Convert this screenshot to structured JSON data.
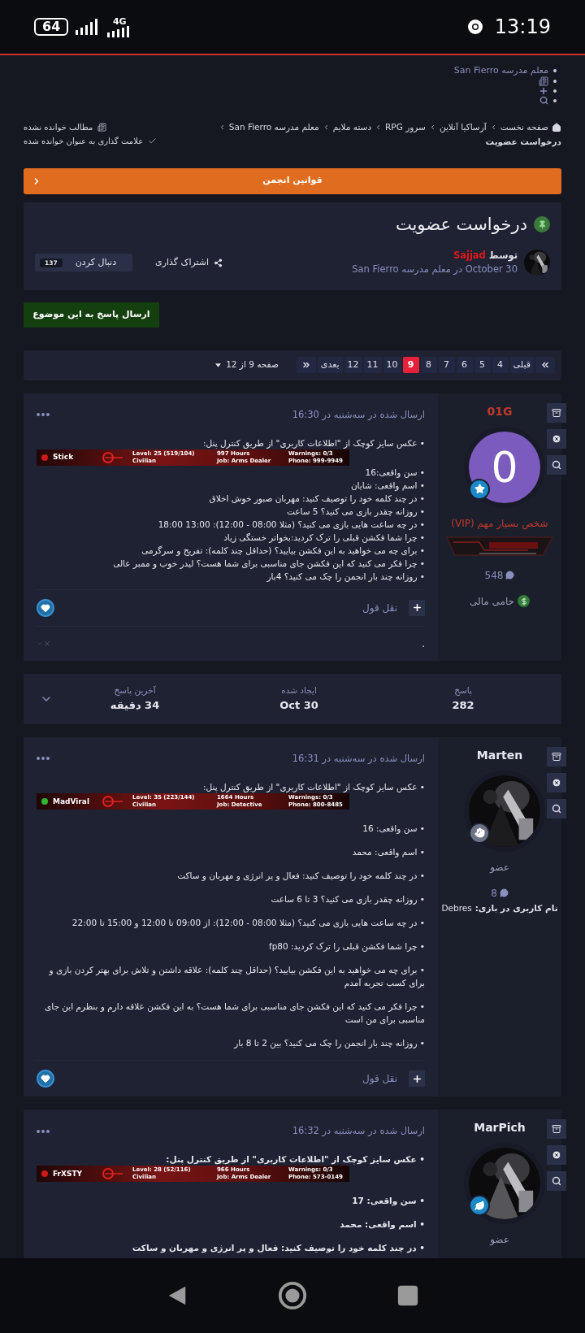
{
  "status_bar": {
    "battery": "64",
    "network": "4G",
    "time": "13:19"
  },
  "nav_list": [
    {
      "kind": "link",
      "label": "معلم مدرسه San Fierro"
    },
    {
      "kind": "unread"
    },
    {
      "kind": "add"
    },
    {
      "kind": "search"
    }
  ],
  "breadcrumb": {
    "items": [
      "صفحه نخست",
      "آرساکیا آنلاین",
      "سرور RPG",
      "دسته ملایم",
      "معلم مدرسه San Fierro"
    ],
    "current": "درخواست عضویت"
  },
  "topic_actions": [
    {
      "kind": "unread",
      "label": "مطالب خوانده نشده"
    },
    {
      "kind": "mark_read",
      "label": "علامت گذاری به عنوان خوانده شده"
    }
  ],
  "rules_bar": {
    "label": "قوانین انجمن"
  },
  "topic": {
    "title": "درخواست عضویت",
    "pinned": true,
    "by_label": "توسط",
    "author": "Sajjad",
    "meta": "October 30 در معلم مدرسه San Fierro",
    "share": "اشتراک گذاری",
    "follow": "دنبال کردن",
    "follow_count": "137"
  },
  "reply_button": "ارسال پاسخ به این موضوع",
  "pagination": {
    "pages": [
      {
        "label": "قبلی",
        "selected": false
      },
      {
        "label": "4",
        "selected": false
      },
      {
        "label": "5",
        "selected": false
      },
      {
        "label": "6",
        "selected": false
      },
      {
        "label": "7",
        "selected": false
      },
      {
        "label": "8",
        "selected": false
      },
      {
        "label": "9",
        "selected": true
      },
      {
        "label": "10",
        "selected": false
      },
      {
        "label": "11",
        "selected": false
      },
      {
        "label": "12",
        "selected": false
      },
      {
        "label": "بعدی",
        "selected": false
      }
    ],
    "page_jump": "صفحه 9 از 12"
  },
  "posts": [
    {
      "author": "01G",
      "color": "#c0392b",
      "avatar": {
        "kind": "letter",
        "letter": "0",
        "color": "#7b5bbd"
      },
      "badge": {
        "kind": "star"
      },
      "role": "شخص بسیار مهم (VIP)",
      "rank_banner": {
        "kind": "picture"
      },
      "post_count": "548",
      "extra": {
        "kind": "donor",
        "label": "حامی مالی"
      },
      "timestamp": "ارسال شده در سه‌شنبه در 16:30",
      "bold": false,
      "spaced": false,
      "intro": "• عکس سایز کوچک از \"اطلاعات کاربری\" از طریق کنترل پنل:",
      "banner": {
        "name": "Stick",
        "color": "#d01818",
        "level": "Level: 25 (519/104)",
        "class": "Civilian",
        "hours": "997 Hours",
        "job": "Job: Arms Dealer",
        "warnings": "Warnings: 0/3",
        "phone": "Phone: 999-9949"
      },
      "lines": [
        "• سن واقعی:16",
        "• اسم واقعی: شایان",
        "• در چند کلمه خود را توصیف کنید: مهربان صبور خوش اخلاق",
        "• روزانه چقدر بازی می کنید؟ 5 ساعت",
        "• در چه ساعت هایی بازی می کنید؟ (مثلا 08:00 - 12:00): 13:00  18:00",
        "• چرا شما فکشن قبلی را ترک کردید:بخواتر خستگی زیاد",
        "• برای چه می خواهید به این فکشن بیایید؟ (حداقل چند کلمه): تفریح و سرگرمی",
        "• چرا فکر می کنید که این فکشن جای مناسبی برای شما هست؟ لیدر خوب و ممبر عالی",
        "• روزانه چند بار انجمن را چک می کنید؟ 4بار"
      ],
      "quote": "نقل قول",
      "signature": "."
    },
    {
      "author": "Marten",
      "color": "#e8e8f0",
      "avatar": {
        "kind": "picture"
      },
      "badge": {
        "kind": "hand"
      },
      "role": "عضو",
      "post_count": "8",
      "extra": {
        "kind": "ingame",
        "label": "نام کاربری در بازی:",
        "value": "Debres"
      },
      "timestamp": "ارسال شده در سه‌شنبه در 16:31",
      "bold": false,
      "spaced": true,
      "intro": "• عکس سایز کوچک از \"اطلاعات کاربری\" از طریق کنترل پنل:",
      "banner": {
        "name": "MadViral",
        "color": "#2eb82e",
        "level": "Level: 35 (223/144)",
        "class": "Civilian",
        "hours": "1664 Hours",
        "job": "Job: Detective",
        "warnings": "Warnings: 0/3",
        "phone": "Phone: 800-8485"
      },
      "lines": [
        "• سن واقعی: 16",
        "• اسم واقعی: محمد",
        "• در چند کلمه خود را توصیف کنید: فعال و پر انرژی و مهربان و ساکت",
        "• روزانه چقدر بازی می کنید؟ 3 تا 6 ساعت",
        "• در چه ساعت هایی بازی می کنید؟ (مثلا 08:00 - 12:00): از 09:00 تا 12:00 و 15:00 تا 22:00",
        "• چرا شما فکشن قبلی را ترک کردید:  fp80",
        "• برای چه می خواهید به این فکشن بیایید؟ (حداقل چند کلمه): علاقه داشتن و تلاش برای بهتر کردن بازی و برای کسب تجربه آمدم",
        "• چرا فکر می کنید که این فکشن جای مناسبی برای شما هست؟ به این فکشن علاقه دارم و بنظرم این جای مناسبی برای من است",
        "• روزانه چند بار انجمن را چک می کنید؟  بین 2 تا 8 بار"
      ],
      "quote": "نقل قول"
    },
    {
      "author": "MarPich",
      "color": "#e8e8f0",
      "avatar": {
        "kind": "picture"
      },
      "badge": {
        "kind": "leaf"
      },
      "role": "عضو",
      "timestamp": "ارسال شده در سه‌شنبه در 16:32",
      "bold": true,
      "spaced": true,
      "intro": "• عکس سایز کوچک از \"اطلاعات کاربری\" از طریق کنترل پنل:",
      "banner": {
        "name": "FrXSTY",
        "color": "#d01818",
        "level": "Level: 28 (52/116)",
        "class": "Civilian",
        "hours": "966 Hours",
        "job": "Job: Arms Dealer",
        "warnings": "Warnings: 0/3",
        "phone": "Phone: 573-0149"
      },
      "lines": [
        "• سن واقعی: 17",
        "• اسم واقعی: محمد",
        "• در چند کلمه خود را توصیف کنید: فعال و پر انرژی و مهربان و ساکت"
      ]
    }
  ],
  "stats": [
    {
      "label": "پاسخ",
      "value": "282"
    },
    {
      "label": "ایجاد شده",
      "value": "Oct 30"
    },
    {
      "label": "آخرین پاسخ",
      "value": "34 دقیقه"
    }
  ]
}
